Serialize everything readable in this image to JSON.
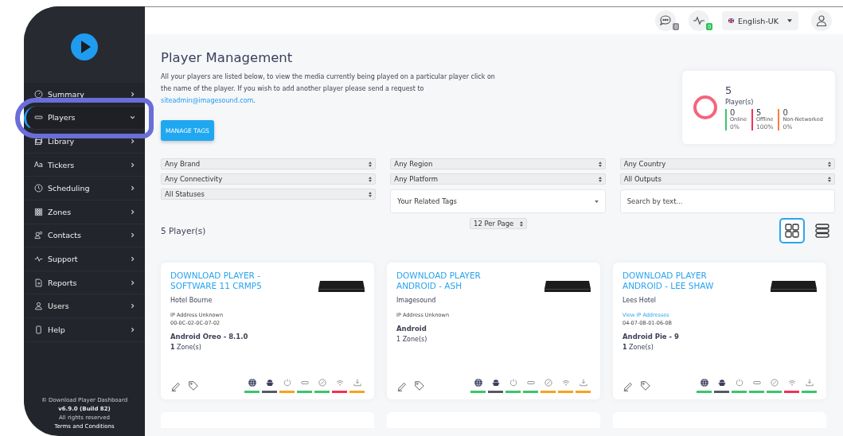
{
  "topbar": {
    "messages_badge": "0",
    "activity_badge": "0",
    "language": "English-UK"
  },
  "sidebar": {
    "items": [
      {
        "label": "Summary",
        "kind": "gauge",
        "selected": false,
        "expanded": false
      },
      {
        "label": "Players",
        "kind": "player",
        "selected": true,
        "expanded": true
      },
      {
        "label": "Library",
        "kind": "library",
        "selected": false,
        "expanded": false
      },
      {
        "label": "Tickers",
        "kind": "text",
        "icon_text": "Aa",
        "selected": false,
        "expanded": false
      },
      {
        "label": "Scheduling",
        "kind": "clock",
        "selected": false,
        "expanded": false
      },
      {
        "label": "Zones",
        "kind": "grid",
        "selected": false,
        "expanded": false
      },
      {
        "label": "Contacts",
        "kind": "contacts",
        "selected": false,
        "expanded": false
      },
      {
        "label": "Support",
        "kind": "pulse",
        "selected": false,
        "expanded": false
      },
      {
        "label": "Reports",
        "kind": "report",
        "selected": false,
        "expanded": false
      },
      {
        "label": "Users",
        "kind": "user",
        "selected": false,
        "expanded": false
      },
      {
        "label": "Help",
        "kind": "phone",
        "selected": false,
        "expanded": false
      }
    ],
    "footer": {
      "copyright": "© Download Player Dashboard",
      "version": "v6.9.0 (Build 82)",
      "rights": "All rights reserved",
      "terms": "Terms and Conditions"
    }
  },
  "page": {
    "title": "Player Management",
    "intro": "All your players are listed below, to view the media currently being played on a particular player click on the name of the player. If you wish to add another player please send a request to",
    "email": "siteadmin@imagesound.com",
    "email_suffix": ".",
    "manage_tags": "MANAGE TAGS"
  },
  "summary": {
    "total": "5",
    "label": "Player(s)",
    "breakdown": [
      {
        "value": "0",
        "label": "Online",
        "percent": "0%",
        "color": "#3ec46d"
      },
      {
        "value": "5",
        "label": "Offline",
        "percent": "100%",
        "color": "#f0325a"
      },
      {
        "value": "0",
        "label": "Non-Networked",
        "percent": "0%",
        "color": "#fb7d3c"
      }
    ]
  },
  "filters": [
    {
      "controls": [
        {
          "kind": "select",
          "value": "Any Brand"
        },
        {
          "kind": "select",
          "value": "Any Connectivity"
        },
        {
          "kind": "select",
          "value": "All Statuses"
        }
      ]
    },
    {
      "controls": [
        {
          "kind": "select",
          "value": "Any Region"
        },
        {
          "kind": "select",
          "value": "Any Platform"
        },
        {
          "kind": "dropdown",
          "value": "Your Related Tags"
        }
      ]
    },
    {
      "controls": [
        {
          "kind": "select",
          "value": "Any Country"
        },
        {
          "kind": "select",
          "value": "All Outputs"
        },
        {
          "kind": "search",
          "placeholder": "Search by text..."
        }
      ]
    }
  ],
  "count": "5 Player(s)",
  "per_page": "12 Per Page",
  "views": [
    {
      "kind": "grid",
      "selected": true
    },
    {
      "kind": "list",
      "selected": false
    }
  ],
  "players": [
    {
      "name": "DOWNLOAD PLAYER - SOFTWARE 11 CRMP5",
      "venue": "Hotel Bourne",
      "ip": {
        "text": "IP Address Unknown",
        "link": false
      },
      "mac": "00-0C-02-0C-07-02",
      "os": "Android Oreo - 8.1.0",
      "zones": "**1** Zone(s)",
      "status": [
        {
          "kind": "globe",
          "color": "#3ec46d"
        },
        {
          "kind": "android",
          "color": "#555a66"
        },
        {
          "kind": "power",
          "color": "#f7a21b"
        },
        {
          "kind": "output",
          "color": "#3ec46d"
        },
        {
          "kind": "sync",
          "color": "#3ec46d"
        },
        {
          "kind": "wifi",
          "color": "#f0325a"
        },
        {
          "kind": "download",
          "color": "#f7a21b"
        }
      ]
    },
    {
      "name": "DOWNLOAD PLAYER ANDROID - ASH",
      "venue": "Imagesound",
      "ip": {
        "text": "IP Address Unknown",
        "link": false
      },
      "os": "Android",
      "zones": "1 Zone(s)",
      "status": [
        {
          "kind": "globe",
          "color": "#3ec46d"
        },
        {
          "kind": "android",
          "color": "#555a66"
        },
        {
          "kind": "power",
          "color": "#3ec46d"
        },
        {
          "kind": "output",
          "color": "#3ec46d"
        },
        {
          "kind": "sync",
          "color": "#f7a21b"
        },
        {
          "kind": "wifi",
          "color": "#f7a21b"
        },
        {
          "kind": "download",
          "color": "#f7a21b"
        }
      ]
    },
    {
      "name": "DOWNLOAD PLAYER ANDROID - LEE SHAW",
      "venue": "Lees Hotel",
      "ip": {
        "text": "View IP Addresses",
        "link": true
      },
      "mac": "04-07-0B-01-06-0B",
      "os": "Android Pie - 9",
      "zones": "**1** Zone(s)",
      "status": [
        {
          "kind": "globe",
          "color": "#3ec46d"
        },
        {
          "kind": "android",
          "color": "#555a66"
        },
        {
          "kind": "power",
          "color": "#3ec46d"
        },
        {
          "kind": "output",
          "color": "#3ec46d"
        },
        {
          "kind": "sync",
          "color": "#3ec46d"
        },
        {
          "kind": "wifi",
          "color": "#f0325a"
        },
        {
          "kind": "download",
          "color": "#3ec46d"
        }
      ]
    }
  ]
}
